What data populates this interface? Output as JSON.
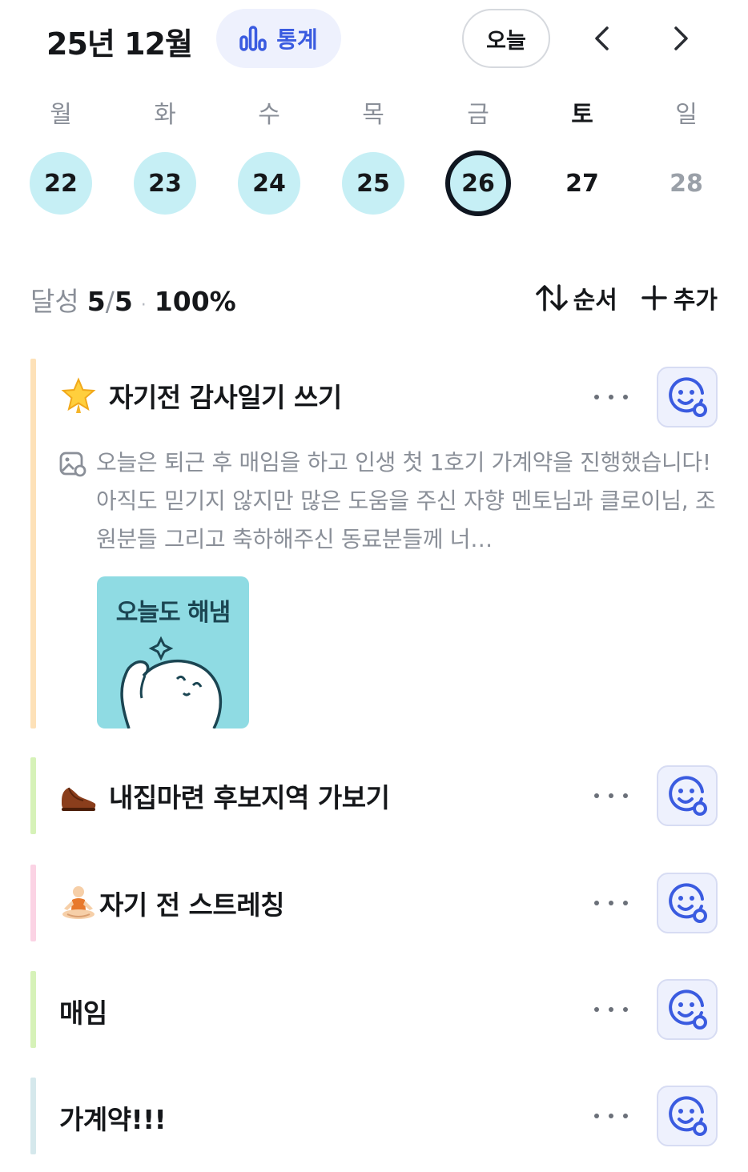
{
  "header": {
    "month_title": "25년 12월",
    "stats_label": "통계",
    "today_label": "오늘",
    "prev_icon": "chevron-left-icon",
    "next_icon": "chevron-right-icon",
    "accent_color": "#3a5be0"
  },
  "week": {
    "weekdays": [
      "월",
      "화",
      "수",
      "목",
      "금",
      "토",
      "일"
    ],
    "days": [
      "22",
      "23",
      "24",
      "25",
      "26",
      "27",
      "28"
    ],
    "completed_color": "#c6eff5"
  },
  "summary": {
    "label": "달성",
    "done": "5",
    "slash": "/",
    "total": "5",
    "separator": "·",
    "percent": "100%",
    "sort_label": "순서",
    "add_label": "추가"
  },
  "tasks": [
    {
      "title": "자기전 감사일기 쓰기",
      "emoji": "glowing-star-icon",
      "bar_color": "#fde1b8",
      "note": "오늘은 퇴근 후 매임을 하고 인생 첫 1호기 가계약을 진행했습니다! 아직도 믿기지 않지만 많은 도움을 주신 자향 멘토님과 클로이님, 조원분들 그리고 축하해주신 동료분들께 너…",
      "sticker_text": "오늘도 해냄"
    },
    {
      "title": "내집마련 후보지역 가보기",
      "emoji": "shoe-icon",
      "bar_color": "#d6f2b8"
    },
    {
      "title": "자기 전 스트레칭",
      "emoji": "person-meditating-icon",
      "bar_color": "#fbd3e4"
    },
    {
      "title": "매임",
      "emoji": "",
      "bar_color": "#d6f2b8"
    },
    {
      "title": "가계약!!!",
      "emoji": "",
      "bar_color": "#d5e8ec"
    }
  ]
}
